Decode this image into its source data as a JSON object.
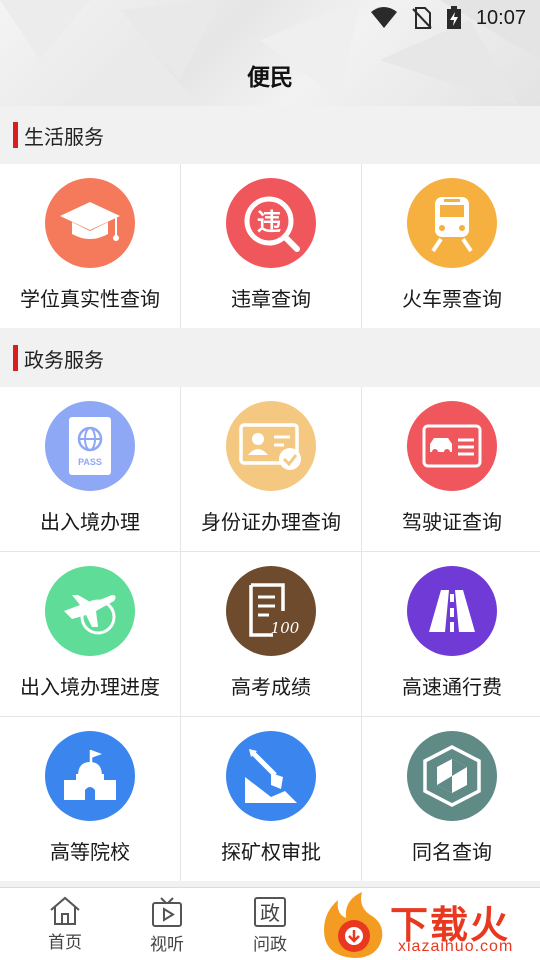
{
  "status_bar": {
    "time": "10:07"
  },
  "header": {
    "title": "便民"
  },
  "sections": [
    {
      "title": "生活服务",
      "items": [
        {
          "label": "学位真实性查询",
          "icon": "graduation-cap-icon",
          "color": "#f47a5b"
        },
        {
          "label": "违章查询",
          "icon": "violation-icon",
          "color": "#f0575d"
        },
        {
          "label": "火车票查询",
          "icon": "train-icon",
          "color": "#f5b03f"
        }
      ]
    },
    {
      "title": "政务服务",
      "items": [
        {
          "label": "出入境办理",
          "icon": "passport-icon",
          "color": "#8ea8f6"
        },
        {
          "label": "身份证办理查询",
          "icon": "id-card-icon",
          "color": "#f5c882"
        },
        {
          "label": "驾驶证查询",
          "icon": "driver-license-icon",
          "color": "#f0575d"
        },
        {
          "label": "出入境办理进度",
          "icon": "airplane-icon",
          "color": "#5edc98"
        },
        {
          "label": "高考成绩",
          "icon": "exam-score-icon",
          "color": "#6e4b2c"
        },
        {
          "label": "高速通行费",
          "icon": "highway-icon",
          "color": "#6f3ad6"
        },
        {
          "label": "高等院校",
          "icon": "school-icon",
          "color": "#3a86ee"
        },
        {
          "label": "探矿权审批",
          "icon": "mining-shovel-icon",
          "color": "#3a86ee"
        },
        {
          "label": "同名查询",
          "icon": "name-shield-icon",
          "color": "#5f8a86"
        }
      ]
    }
  ],
  "bottom_nav": [
    {
      "label": "首页",
      "icon": "home-icon"
    },
    {
      "label": "视听",
      "icon": "tv-play-icon"
    },
    {
      "label": "问政",
      "icon": "zheng-icon",
      "glyph": "政"
    }
  ],
  "brand": {
    "name": "下载火",
    "sub": "xiazaihuo.com"
  }
}
